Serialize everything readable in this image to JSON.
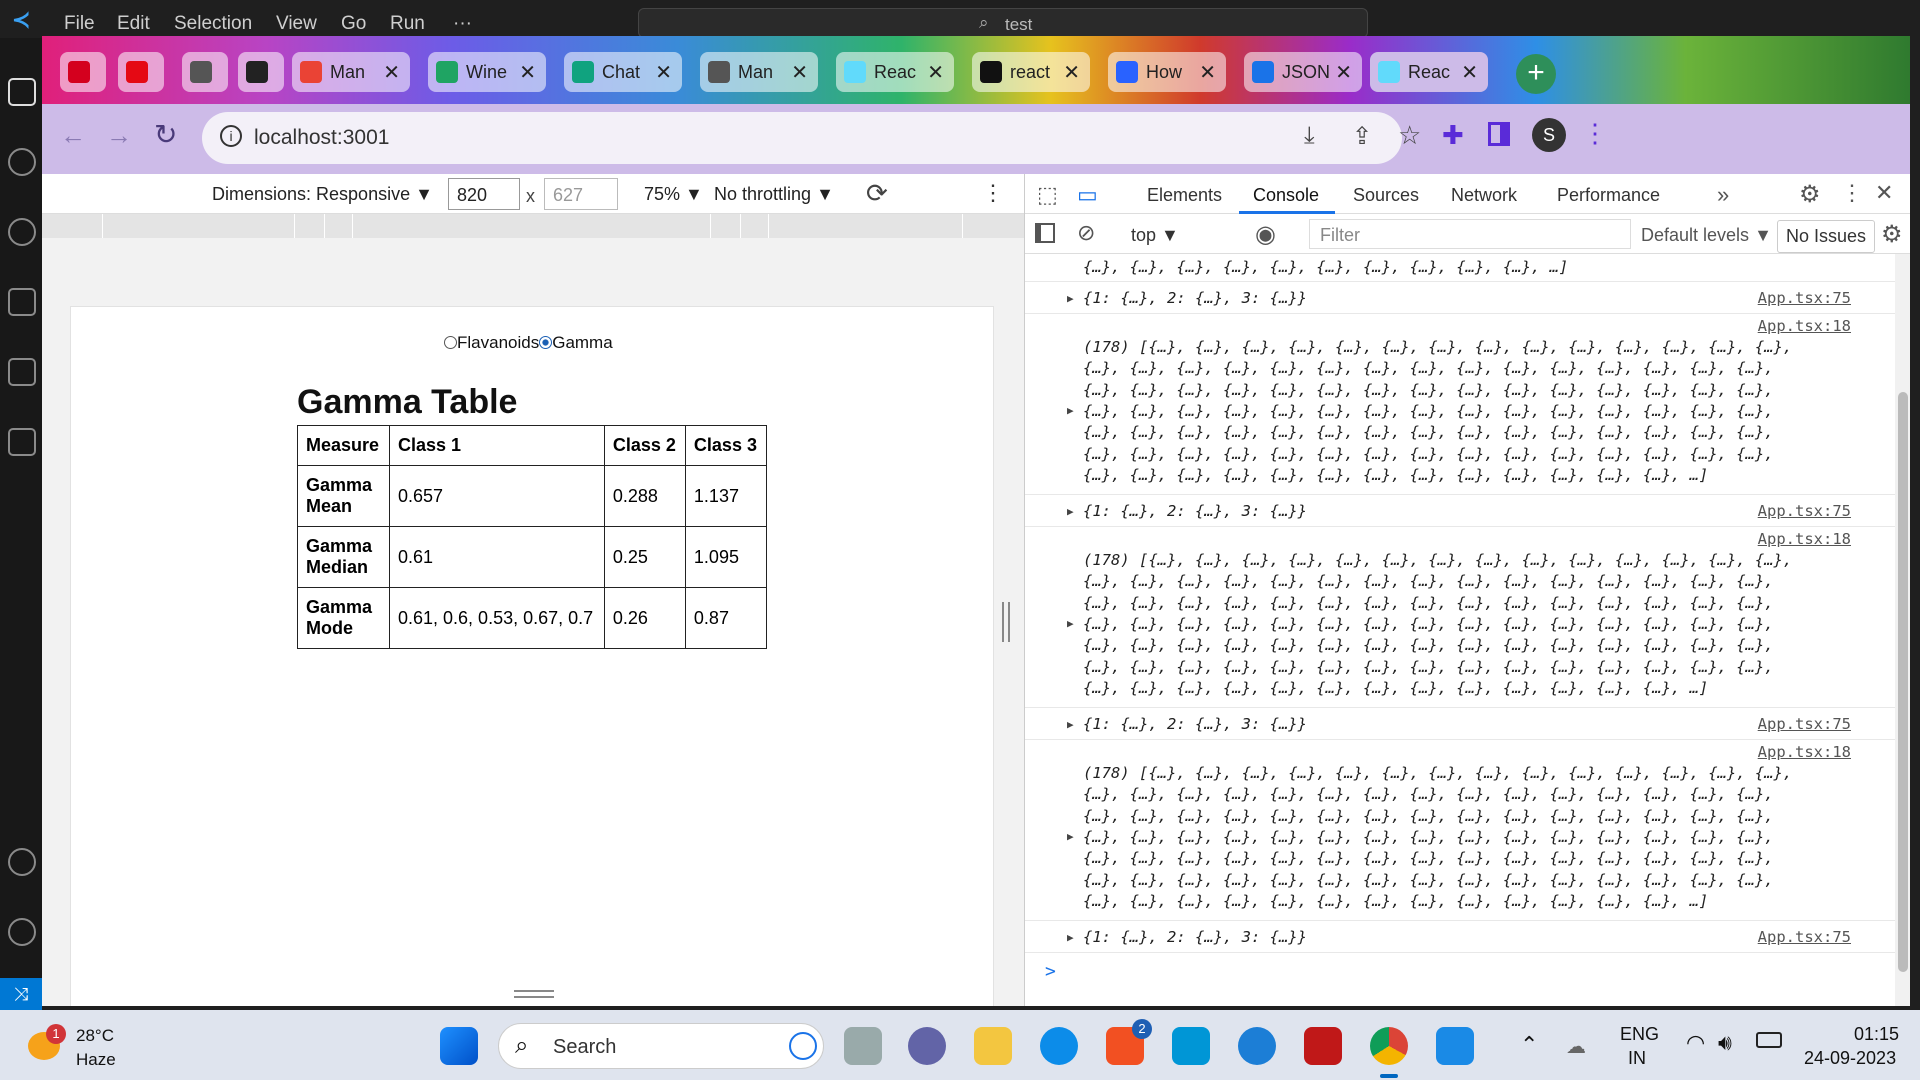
{
  "vscode": {
    "menu": [
      "File",
      "Edit",
      "Selection",
      "View",
      "Go",
      "Run",
      "···"
    ],
    "search": "test"
  },
  "browser": {
    "tabs": [
      {
        "label": "",
        "icon": "mcafee-icon",
        "color": "#d4001e"
      },
      {
        "label": "",
        "icon": "netflix-icon",
        "color": "#e50914"
      },
      {
        "label": "",
        "icon": "globe-icon",
        "color": "#555"
      },
      {
        "label": "",
        "icon": "tv-icon",
        "color": "#222"
      },
      {
        "label": "Man",
        "icon": "gmail-icon",
        "color": "#ea4335"
      },
      {
        "label": "Wine",
        "icon": "drive-icon",
        "color": "#1fa463"
      },
      {
        "label": "Chat",
        "icon": "chatgpt-icon",
        "color": "#10a37f"
      },
      {
        "label": "Man",
        "icon": "globe-icon",
        "color": "#555"
      },
      {
        "label": "Reac",
        "icon": "react-icon",
        "color": "#61dafb"
      },
      {
        "label": "react",
        "icon": "github-icon",
        "color": "#111"
      },
      {
        "label": "How",
        "icon": "hashnode-icon",
        "color": "#2962ff"
      },
      {
        "label": "JSON",
        "icon": "json-icon",
        "color": "#1a73e8"
      },
      {
        "label": "Reac",
        "icon": "react-icon",
        "color": "#61dafb"
      }
    ],
    "url": "localhost:3001",
    "profile_initial": "S"
  },
  "device_toolbar": {
    "dimensions_label": "Dimensions: Responsive",
    "width": "820",
    "height": "627",
    "times": "x",
    "zoom": "75%",
    "throttling": "No throttling"
  },
  "page": {
    "radio_flavanoids": "Flavanoids",
    "radio_gamma": "Gamma",
    "selected": "Gamma",
    "table_title": "Gamma Table",
    "headers": [
      "Measure",
      "Class 1",
      "Class 2",
      "Class 3"
    ],
    "rows": [
      {
        "measure": "Gamma Mean",
        "c1": "0.657",
        "c2": "0.288",
        "c3": "1.137"
      },
      {
        "measure": "Gamma Median",
        "c1": "0.61",
        "c2": "0.25",
        "c3": "1.095"
      },
      {
        "measure": "Gamma Mode",
        "c1": "0.61, 0.6, 0.53, 0.67, 0.7",
        "c2": "0.26",
        "c3": "0.87"
      }
    ]
  },
  "devtools": {
    "tabs": [
      "Elements",
      "Console",
      "Sources",
      "Network",
      "Performance"
    ],
    "active_tab": "Console",
    "context": "top",
    "filter_placeholder": "Filter",
    "levels": "Default levels",
    "issues": "No Issues",
    "top_fragment": "{…}, {…}, {…}, {…}, {…}, {…}, {…}, {…}, {…}, {…}, …]",
    "object_line": "{1: {…}, 2: {…}, 3: {…}}",
    "array_first": "(178) [{…}, {…}, {…}, {…}, {…}, {…}, {…}, {…}, {…}, {…}, {…}, {…}, {…}, {…},",
    "array_mid": "{…}, {…}, {…}, {…}, {…}, {…}, {…}, {…}, {…}, {…}, {…}, {…}, {…}, {…}, {…},",
    "array_last": "{…}, {…}, {…}, {…}, {…}, {…}, {…}, {…}, {…}, {…}, {…}, {…}, {…}, …]",
    "src_obj": "App.tsx:75",
    "src_arr": "App.tsx:18",
    "prompt": ">"
  },
  "taskbar": {
    "weather_temp": "28°C",
    "weather_desc": "Haze",
    "weather_badge": "1",
    "search": "Search",
    "store_badge": "2",
    "lang1": "ENG",
    "lang2": "IN",
    "time": "01:15",
    "date": "24-09-2023"
  }
}
